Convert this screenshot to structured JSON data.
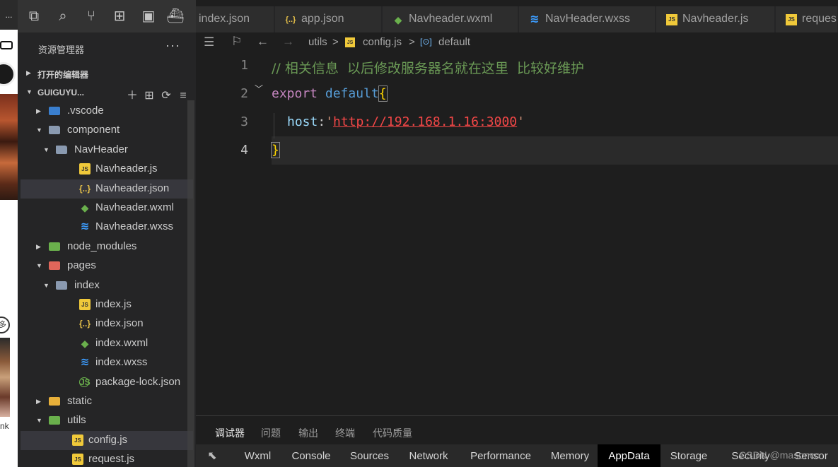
{
  "simulator": {
    "top_text": "...",
    "bottom_label": "nk",
    "circle_glyph": "多"
  },
  "activity_icons": [
    "explorer-icon",
    "search-icon",
    "source-control-icon",
    "extensions-icon",
    "debug-icon",
    "docker-icon"
  ],
  "sidebar": {
    "title": "资源管理器",
    "more": "···",
    "open_editors": "打开的编辑器",
    "project": "GUIGUYU...",
    "tools": [
      "＋",
      "⊞",
      "⟳",
      "≡"
    ],
    "tree": [
      {
        "name": ".vscode",
        "kind": "folder-vscode",
        "level": 0,
        "open": false
      },
      {
        "name": "component",
        "kind": "folder",
        "level": 0,
        "open": true
      },
      {
        "name": "NavHeader",
        "kind": "folder",
        "level": 1,
        "open": true
      },
      {
        "name": "Navheader.js",
        "kind": "js",
        "level": 2
      },
      {
        "name": "Navheader.json",
        "kind": "json",
        "level": 2,
        "selected": true
      },
      {
        "name": "Navheader.wxml",
        "kind": "wxml",
        "level": 2
      },
      {
        "name": "Navheader.wxss",
        "kind": "wxss",
        "level": 2
      },
      {
        "name": "node_modules",
        "kind": "folder-node",
        "level": 0,
        "open": false
      },
      {
        "name": "pages",
        "kind": "folder-pages",
        "level": 0,
        "open": true
      },
      {
        "name": "index",
        "kind": "folder",
        "level": 1,
        "open": true
      },
      {
        "name": "index.js",
        "kind": "js",
        "level": 2
      },
      {
        "name": "index.json",
        "kind": "json",
        "level": 2
      },
      {
        "name": "index.wxml",
        "kind": "wxml",
        "level": 2
      },
      {
        "name": "index.wxss",
        "kind": "wxss",
        "level": 2
      },
      {
        "name": "package-lock.json",
        "kind": "pkg",
        "level": 2
      },
      {
        "name": "static",
        "kind": "folder-static",
        "level": 0,
        "open": false
      },
      {
        "name": "utils",
        "kind": "folder-utils",
        "level": 0,
        "open": true
      },
      {
        "name": "config.js",
        "kind": "js",
        "level": 1,
        "selected": true
      },
      {
        "name": "request.js",
        "kind": "js",
        "level": 1
      }
    ]
  },
  "tabs": [
    {
      "label": "index.json",
      "icon": "none"
    },
    {
      "label": "app.json",
      "icon": "json"
    },
    {
      "label": "Navheader.wxml",
      "icon": "wxml"
    },
    {
      "label": "NavHeader.wxss",
      "icon": "wxss"
    },
    {
      "label": "Navheader.js",
      "icon": "js"
    },
    {
      "label": "reques",
      "icon": "js"
    }
  ],
  "breadcrumb": {
    "folder": "utils",
    "file": "config.js",
    "symbol": "default",
    "sep": ">"
  },
  "editor": {
    "line_numbers": [
      "1",
      "2",
      "3",
      "4"
    ],
    "comment": "// 相关信息  以后修改服务器名就在这里  比较好维护",
    "line2_export": "export",
    "line2_default": "default",
    "line2_brace": "{",
    "line3_prop": "host",
    "line3_colon": ":",
    "line3_quote_open": "'",
    "line3_url": "http://192.168.1.16:3000",
    "line3_quote_close": "'",
    "line4_brace": "}"
  },
  "panel": {
    "tabs": [
      "调试器",
      "问题",
      "输出",
      "终端",
      "代码质量"
    ],
    "devtools": [
      "Wxml",
      "Console",
      "Sources",
      "Network",
      "Performance",
      "Memory",
      "AppData",
      "Storage",
      "Security",
      "Sensor"
    ],
    "active_devtool": "AppData",
    "watermark": "CSDN @masonco"
  }
}
